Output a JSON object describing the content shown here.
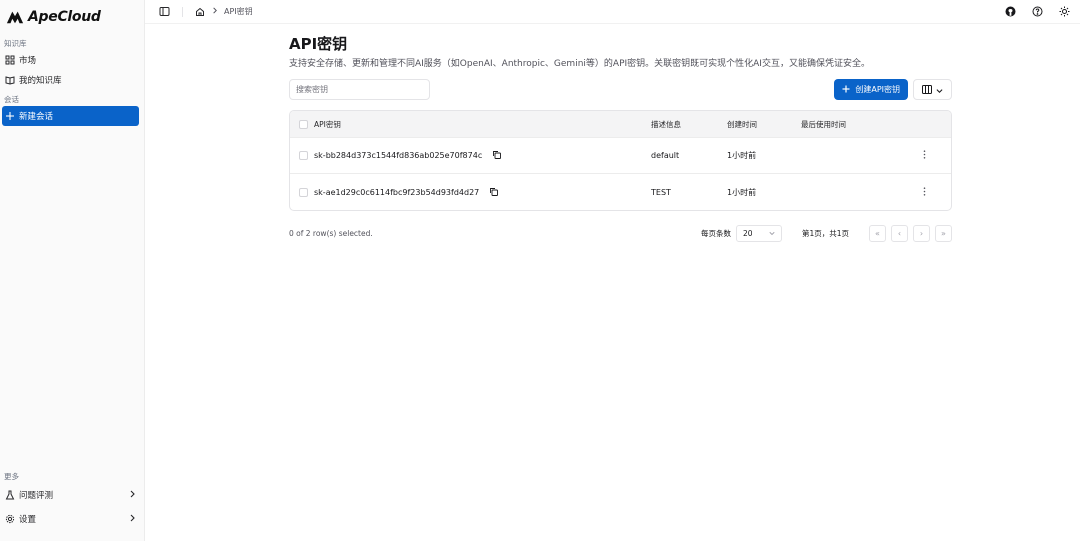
{
  "brand": {
    "name": "ApeCloud"
  },
  "sidebar": {
    "sections": [
      {
        "label": "知识库",
        "items": [
          {
            "label": "市场",
            "icon": "grid-icon"
          },
          {
            "label": "我的知识库",
            "icon": "book-icon"
          }
        ]
      },
      {
        "label": "会话",
        "items": [
          {
            "label": "新建会话",
            "icon": "plus-icon",
            "active": true
          }
        ]
      }
    ],
    "more": {
      "label": "更多",
      "items": [
        {
          "label": "问题评测",
          "icon": "flask-icon"
        },
        {
          "label": "设置",
          "icon": "gear-icon"
        }
      ]
    }
  },
  "topbar": {
    "breadcrumb": [
      "API密钥"
    ],
    "icons": [
      "sidebar-toggle-icon",
      "home-icon",
      "github-icon",
      "help-icon",
      "sun-icon"
    ]
  },
  "page": {
    "title": "API密钥",
    "description": "支持安全存储、更新和管理不同AI服务（如OpenAI、Anthropic、Gemini等）的API密钥。关联密钥既可实现个性化AI交互，又能确保凭证安全。",
    "search_placeholder": "搜索密钥",
    "create_button": "创建API密钥",
    "accent_color": "#0a63c9"
  },
  "table": {
    "columns": [
      "API密钥",
      "描述信息",
      "创建时间",
      "最后使用时间"
    ],
    "rows": [
      {
        "key": "sk-bb284d373c1544fd836ab025e70f874c",
        "description": "default",
        "created": "1小时前",
        "last_used": ""
      },
      {
        "key": "sk-ae1d29c0c6114fbc9f23b54d93fd4d27",
        "description": "TEST",
        "created": "1小时前",
        "last_used": ""
      }
    ]
  },
  "footer": {
    "selection": "0 of 2 row(s) selected.",
    "per_page_label": "每页条数",
    "per_page_value": "20",
    "page_info": "第1页，共1页"
  }
}
